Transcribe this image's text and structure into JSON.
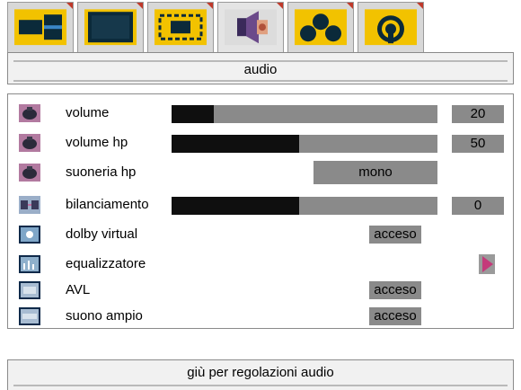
{
  "tabs": [
    {
      "icon": "picture-layout-icon"
    },
    {
      "icon": "tv-screen-icon"
    },
    {
      "icon": "screen-adjust-icon"
    },
    {
      "icon": "speaker-audio-icon"
    },
    {
      "icon": "source-connections-icon"
    },
    {
      "icon": "wireless-signal-icon"
    }
  ],
  "title": "audio",
  "rows": {
    "volume": {
      "label": "volume",
      "value": "20",
      "level": 0.16,
      "icon": "speaker-icon"
    },
    "volume_hp": {
      "label": "volume hp",
      "value": "50",
      "level": 0.48,
      "icon": "speaker-icon"
    },
    "suoneria_hp": {
      "label": "suoneria hp",
      "option": "mono",
      "icon": "speaker-icon"
    },
    "bilanciamento": {
      "label": "bilanciamento",
      "value": "0",
      "level": 0.48,
      "icon": "balance-speakers-icon"
    },
    "dolby_virtual": {
      "label": "dolby virtual",
      "status": "acceso",
      "icon": "dolby-icon"
    },
    "equalizzatore": {
      "label": "equalizzatore",
      "icon": "equalizer-icon"
    },
    "avl": {
      "label": "AVL",
      "status": "acceso",
      "icon": "avl-icon"
    },
    "suono_ampio": {
      "label": "suono ampio",
      "status": "acceso",
      "icon": "wide-sound-icon"
    }
  },
  "footer": "giù per regolazioni audio",
  "colors": {
    "tab_icon_yellow": "#f2c200",
    "tab_icon_dark": "#0b2a3a",
    "tab_corner": "#c0392b",
    "slider_track": "#8a8a8a",
    "slider_fill": "#0f0f0f",
    "arrow": "#c43a7a"
  }
}
